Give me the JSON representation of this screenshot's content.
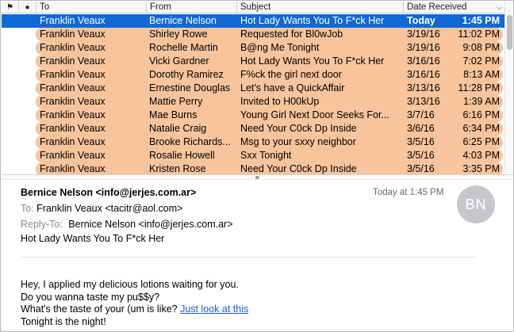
{
  "columns": {
    "flag": "⚑",
    "unread": "●",
    "to": "To",
    "from": "From",
    "subject": "Subject",
    "date": "Date Received"
  },
  "messages": [
    {
      "to": "Franklin Veaux",
      "from": "Bernice Nelson",
      "subject": "Hot Lady Wants You To F*ck Her",
      "date": "Today",
      "time": "1:45 PM",
      "selected": true
    },
    {
      "to": "Franklin Veaux",
      "from": "Shirley Rowe",
      "subject": "Requested for Bl0wJob",
      "date": "3/19/16",
      "time": "11:02 PM"
    },
    {
      "to": "Franklin Veaux",
      "from": "Rochelle Martin",
      "subject": "B@ng Me Tonight",
      "date": "3/19/16",
      "time": "9:08 PM"
    },
    {
      "to": "Franklin Veaux",
      "from": "Vicki Gardner",
      "subject": "Hot Lady Wants You To F*ck Her",
      "date": "3/16/16",
      "time": "7:02 PM"
    },
    {
      "to": "Franklin Veaux",
      "from": "Dorothy Ramirez",
      "subject": "F%ck the girl next door",
      "date": "3/16/16",
      "time": "8:13 AM"
    },
    {
      "to": "Franklin Veaux",
      "from": "Ernestine Douglas",
      "subject": "Let's have a QuickAffair",
      "date": "3/13/16",
      "time": "11:28 PM"
    },
    {
      "to": "Franklin Veaux",
      "from": "Mattie Perry",
      "subject": "Invited to H00kUp",
      "date": "3/13/16",
      "time": "1:39 AM"
    },
    {
      "to": "Franklin Veaux",
      "from": "Mae Burns",
      "subject": "Young Girl Next Door Seeks For...",
      "date": "3/7/16",
      "time": "6:16 PM"
    },
    {
      "to": "Franklin Veaux",
      "from": "Natalie Craig",
      "subject": "Need Your C0ck Dp Inside",
      "date": "3/6/16",
      "time": "6:34 PM"
    },
    {
      "to": "Franklin Veaux",
      "from": "Brooke Richards...",
      "subject": "Msg to your sxxy neighbor",
      "date": "3/5/16",
      "time": "6:25 PM"
    },
    {
      "to": "Franklin Veaux",
      "from": "Rosalie Howell",
      "subject": "Sxx Tonight",
      "date": "3/5/16",
      "time": "4:03 PM"
    },
    {
      "to": "Franklin Veaux",
      "from": "Kristen Rose",
      "subject": "Need Your C0ck Dp Inside",
      "date": "3/5/16",
      "time": "3:35 PM"
    }
  ],
  "preview": {
    "sender": "Bernice Nelson <info@jerjes.com.ar>",
    "received": "Today at 1:45 PM",
    "avatar_initials": "BN",
    "to_label": "To:",
    "to_value": "Franklin Veaux <tacitr@aol.com>",
    "replyto_label": "Reply-To:",
    "replyto_value": "Bernice Nelson <info@jerjes.com.ar>",
    "subject": "Hot Lady Wants You To F*ck Her",
    "body": {
      "line1": "Hey, I applied my delicious lotions waiting for you.",
      "line2": "Do you wanna taste my pu$$y?",
      "line3": "What's the taste of your (um is like?",
      "link": "Just look at this",
      "line4": "Tonight is the night!"
    }
  },
  "colors": {
    "selected_row": "#0f6ad8",
    "highlight_row": "#f7c49c",
    "link": "#1a5fd6",
    "avatar": "#c7c7cc"
  }
}
